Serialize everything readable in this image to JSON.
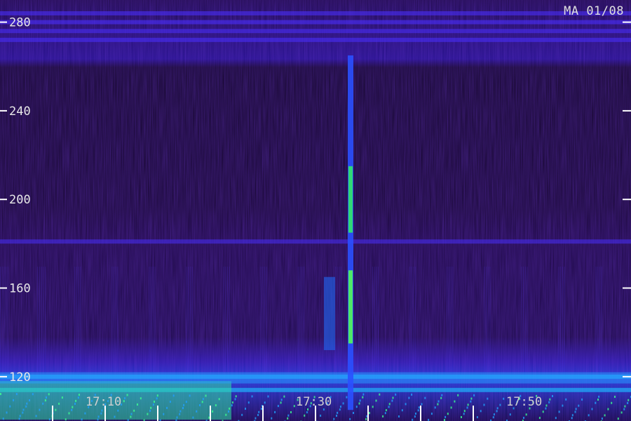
{
  "station_label": "MA 01/08",
  "chart_data": {
    "type": "heatmap",
    "title": "",
    "xlabel": "",
    "ylabel": "",
    "x_ticks": [
      "17:10",
      "17:30",
      "17:50"
    ],
    "y_ticks": [
      120,
      160,
      200,
      240,
      280
    ],
    "ylim": [
      100,
      290
    ],
    "grid": false,
    "horizontal_bands": [
      {
        "y": 284,
        "intensity": 0.55
      },
      {
        "y": 280,
        "intensity": 0.6
      },
      {
        "y": 276,
        "intensity": 0.5
      },
      {
        "y": 272,
        "intensity": 0.55
      },
      {
        "y": 181,
        "intensity": 0.45
      },
      {
        "y": 120,
        "intensity": 0.7
      },
      {
        "y": 114,
        "intensity": 0.8
      }
    ],
    "burst_event": {
      "time": "17:27",
      "freq_range": [
        105,
        265
      ],
      "peak_freq": 200,
      "peak_intensity": 1.0
    },
    "colors": {
      "low": "#1a0030",
      "mid": "#3a10c8",
      "high": "#2ce070"
    }
  }
}
